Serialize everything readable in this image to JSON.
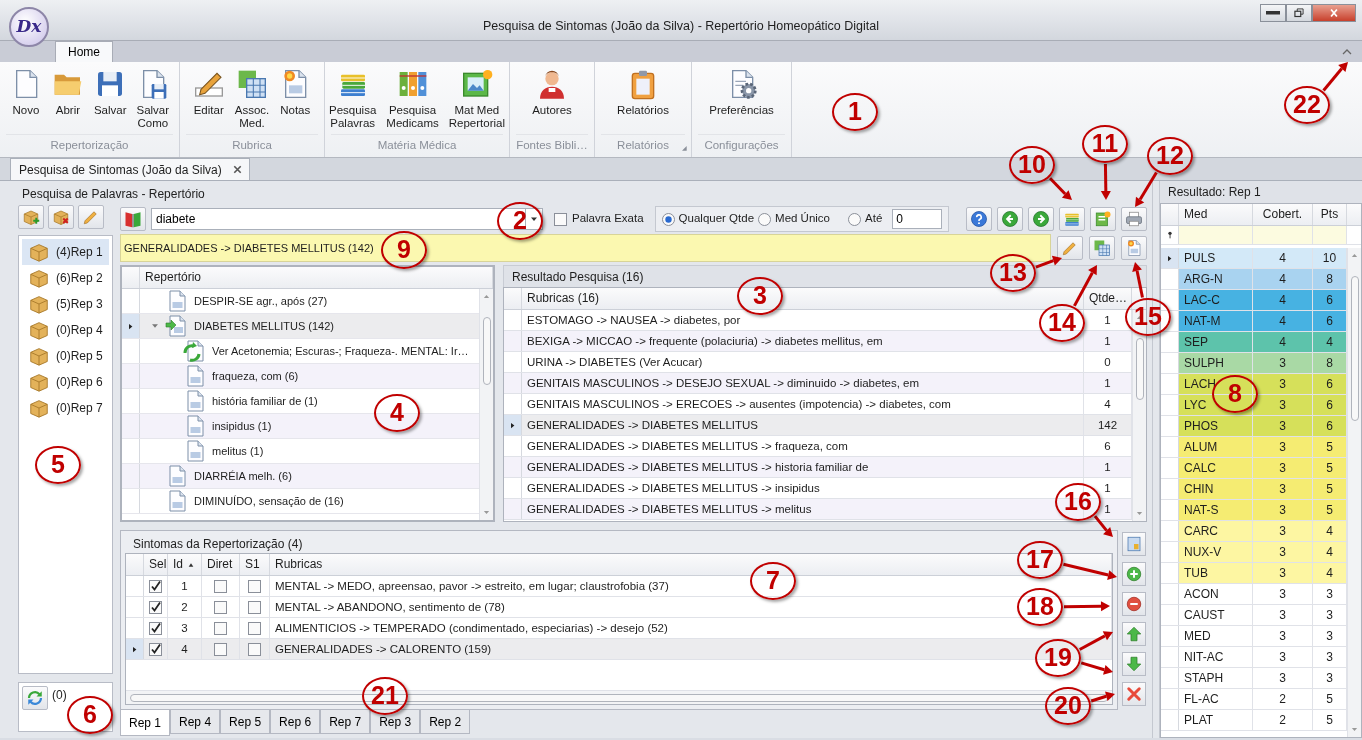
{
  "window": {
    "title": "Pesquisa de Sintomas (João da Silva) - Repertório Homeopático Digital",
    "logo": "Dx"
  },
  "ribbon": {
    "tabs": [
      {
        "label": "Home",
        "selected": true
      }
    ],
    "groups": [
      {
        "label": "Repertorização",
        "launcher": false,
        "buttons": [
          {
            "label": "Novo",
            "kind": "new"
          },
          {
            "label": "Abrir",
            "kind": "open"
          },
          {
            "label": "Salvar",
            "kind": "save"
          },
          {
            "label": "Salvar\nComo",
            "kind": "saveas"
          }
        ]
      },
      {
        "label": "Rubrica",
        "launcher": false,
        "buttons": [
          {
            "label": "Editar",
            "kind": "edit"
          },
          {
            "label": "Assoc.\nMed.",
            "kind": "grid"
          },
          {
            "label": "Notas",
            "kind": "note"
          }
        ]
      },
      {
        "label": "Matéria Médica",
        "launcher": false,
        "buttons": [
          {
            "label": "Pesquisa\nPalavras",
            "kind": "books"
          },
          {
            "label": "Pesquisa\nMedicams",
            "kind": "binders"
          },
          {
            "label": "Mat Med\nRepertorial",
            "kind": "picture"
          }
        ]
      },
      {
        "label": "Fontes Bibli…",
        "launcher": false,
        "buttons": [
          {
            "label": "Autores",
            "kind": "person"
          }
        ]
      },
      {
        "label": "Relatórios",
        "launcher": true,
        "buttons": [
          {
            "label": "Relatórios",
            "kind": "report"
          }
        ]
      },
      {
        "label": "Configurações",
        "launcher": false,
        "buttons": [
          {
            "label": "Preferências",
            "kind": "prefs"
          }
        ]
      }
    ]
  },
  "doc_tabs": [
    {
      "label": "Pesquisa de Sintomas (João da Silva)",
      "selected": true
    }
  ],
  "search_panel": {
    "title": "Pesquisa de Palavras - Repertório",
    "query": "diabete",
    "exact_word": {
      "label": "Palavra Exata",
      "checked": false
    },
    "modes": [
      {
        "label": "Qualquer Qtde",
        "selected": true
      },
      {
        "label": "Med Único",
        "selected": false
      },
      {
        "label": "Até",
        "selected": false
      }
    ],
    "limit": "0",
    "current_rubric": "GENERALIDADES -> DIABETES MELLITUS (142)"
  },
  "repertories": [
    {
      "label": "(4)Rep 1",
      "selected": true
    },
    {
      "label": "(6)Rep 2",
      "selected": false
    },
    {
      "label": "(5)Rep 3",
      "selected": false
    },
    {
      "label": "(0)Rep 4",
      "selected": false
    },
    {
      "label": "(0)Rep 5",
      "selected": false
    },
    {
      "label": "(0)Rep 6",
      "selected": false
    },
    {
      "label": "(0)Rep 7",
      "selected": false
    }
  ],
  "trash": {
    "count": "(0)"
  },
  "tree": {
    "header": "Repertório",
    "items": [
      {
        "label": "DESPIR-SE agr., após (27)",
        "kind": "page",
        "selected": false
      },
      {
        "label": "DIABETES MELLITUS (142)",
        "kind": "page-go",
        "selected": true,
        "expanded": true,
        "children": [
          {
            "label": "Ver Acetonemia; Escuras-; Fraqueza-. MENTAL: Ir…",
            "kind": "link",
            "selected": false
          },
          {
            "label": "fraqueza, com (6)",
            "kind": "page",
            "selected": false
          },
          {
            "label": "história familiar de (1)",
            "kind": "page",
            "selected": false
          },
          {
            "label": "insipidus (1)",
            "kind": "page",
            "selected": false
          },
          {
            "label": "melitus (1)",
            "kind": "page",
            "selected": false
          }
        ]
      },
      {
        "label": "DIARRÉIA melh. (6)",
        "kind": "page",
        "selected": false
      },
      {
        "label": "DIMINUÍDO, sensação de (16)",
        "kind": "page",
        "selected": false
      }
    ]
  },
  "results": {
    "title": "Resultado Pesquisa (16)",
    "columns": [
      "Rubricas (16)",
      "Qtde…"
    ],
    "rows": [
      {
        "rubric": "ESTOMAGO -> NAUSEA -> diabetes, por",
        "qty": "1",
        "selected": false
      },
      {
        "rubric": "BEXIGA -> MICCAO -> frequente (polaciuria) -> diabetes mellitus, em",
        "qty": "1",
        "selected": false
      },
      {
        "rubric": "URINA -> DIABETES (Ver Acucar)",
        "qty": "0",
        "selected": false
      },
      {
        "rubric": "GENITAIS MASCULINOS -> DESEJO SEXUAL -> diminuido -> diabetes, em",
        "qty": "1",
        "selected": false
      },
      {
        "rubric": "GENITAIS MASCULINOS -> ERECOES -> ausentes (impotencia) -> diabetes, com",
        "qty": "4",
        "selected": false
      },
      {
        "rubric": "GENERALIDADES -> DIABETES MELLITUS",
        "qty": "142",
        "selected": true
      },
      {
        "rubric": "GENERALIDADES -> DIABETES MELLITUS -> fraqueza, com",
        "qty": "6",
        "selected": false
      },
      {
        "rubric": "GENERALIDADES -> DIABETES MELLITUS -> historia familiar de",
        "qty": "1",
        "selected": false
      },
      {
        "rubric": "GENERALIDADES -> DIABETES MELLITUS -> insipidus",
        "qty": "1",
        "selected": false
      },
      {
        "rubric": "GENERALIDADES -> DIABETES MELLITUS -> melitus",
        "qty": "1",
        "selected": false
      }
    ]
  },
  "symptoms": {
    "title": "Sintomas da Repertorização (4)",
    "columns": [
      {
        "label": "Sel",
        "sorted": false
      },
      {
        "label": "Id",
        "sorted": true
      },
      {
        "label": "Diret",
        "sorted": false
      },
      {
        "label": "S1",
        "sorted": false
      },
      {
        "label": "Rubricas",
        "sorted": false
      }
    ],
    "rows": [
      {
        "sel": true,
        "id": "1",
        "diret": false,
        "s1": false,
        "rubric": "MENTAL -> MEDO, apreensao, pavor -> estreito, em lugar; claustrofobia (37)",
        "selected": false
      },
      {
        "sel": true,
        "id": "2",
        "diret": false,
        "s1": false,
        "rubric": "MENTAL -> ABANDONO, sentimento de (78)",
        "selected": false
      },
      {
        "sel": true,
        "id": "3",
        "diret": false,
        "s1": false,
        "rubric": "ALIMENTICIOS -> TEMPERADO (condimentado, especiarias) -> desejo (52)",
        "selected": false
      },
      {
        "sel": true,
        "id": "4",
        "diret": false,
        "s1": false,
        "rubric": "GENERALIDADES -> CALORENTO (159)",
        "selected": true
      }
    ]
  },
  "rep_tabs": [
    {
      "label": "Rep 1",
      "selected": true
    },
    {
      "label": "Rep 4",
      "selected": false
    },
    {
      "label": "Rep 5",
      "selected": false
    },
    {
      "label": "Rep 6",
      "selected": false
    },
    {
      "label": "Rep 7",
      "selected": false
    },
    {
      "label": "Rep 3",
      "selected": false
    },
    {
      "label": "Rep 2",
      "selected": false
    }
  ],
  "result_panel": {
    "title": "Resultado: Rep 1",
    "columns": [
      "Med",
      "Cobert.",
      "Pts"
    ],
    "rows": [
      {
        "med": "PULS",
        "coverage": "4",
        "points": "10",
        "color": "#d3e9f8",
        "selected": true
      },
      {
        "med": "ARG-N",
        "coverage": "4",
        "points": "8",
        "color": "#a9d3f0",
        "selected": false
      },
      {
        "med": "LAC-C",
        "coverage": "4",
        "points": "6",
        "color": "#47b2e2",
        "selected": false
      },
      {
        "med": "NAT-M",
        "coverage": "4",
        "points": "6",
        "color": "#47b2e2",
        "selected": false
      },
      {
        "med": "SEP",
        "coverage": "4",
        "points": "4",
        "color": "#5dc3ab",
        "selected": false
      },
      {
        "med": "SULPH",
        "coverage": "3",
        "points": "8",
        "color": "#a9d9a5",
        "selected": false
      },
      {
        "med": "LACH",
        "coverage": "3",
        "points": "6",
        "color": "#d6e05a",
        "selected": false
      },
      {
        "med": "LYC",
        "coverage": "3",
        "points": "6",
        "color": "#d6e05a",
        "selected": false
      },
      {
        "med": "PHOS",
        "coverage": "3",
        "points": "6",
        "color": "#d6e05a",
        "selected": false
      },
      {
        "med": "ALUM",
        "coverage": "3",
        "points": "5",
        "color": "#f5ec72",
        "selected": false
      },
      {
        "med": "CALC",
        "coverage": "3",
        "points": "5",
        "color": "#f5ec72",
        "selected": false
      },
      {
        "med": "CHIN",
        "coverage": "3",
        "points": "5",
        "color": "#f5ec72",
        "selected": false
      },
      {
        "med": "NAT-S",
        "coverage": "3",
        "points": "5",
        "color": "#f5ec72",
        "selected": false
      },
      {
        "med": "CARC",
        "coverage": "3",
        "points": "4",
        "color": "#fdf6a2",
        "selected": false
      },
      {
        "med": "NUX-V",
        "coverage": "3",
        "points": "4",
        "color": "#fdf6a2",
        "selected": false
      },
      {
        "med": "TUB",
        "coverage": "3",
        "points": "4",
        "color": "#fdf6a2",
        "selected": false
      },
      {
        "med": "ACON",
        "coverage": "3",
        "points": "3",
        "color": "#ffffff",
        "selected": false
      },
      {
        "med": "CAUST",
        "coverage": "3",
        "points": "3",
        "color": "#ffffff",
        "selected": false
      },
      {
        "med": "MED",
        "coverage": "3",
        "points": "3",
        "color": "#ffffff",
        "selected": false
      },
      {
        "med": "NIT-AC",
        "coverage": "3",
        "points": "3",
        "color": "#ffffff",
        "selected": false
      },
      {
        "med": "STAPH",
        "coverage": "3",
        "points": "3",
        "color": "#ffffff",
        "selected": false
      },
      {
        "med": "FL-AC",
        "coverage": "2",
        "points": "5",
        "color": "#ffffff",
        "selected": false
      },
      {
        "med": "PLAT",
        "coverage": "2",
        "points": "5",
        "color": "#ffffff",
        "selected": false
      }
    ]
  },
  "annotations": [
    {
      "number": "1"
    },
    {
      "number": "2"
    },
    {
      "number": "3"
    },
    {
      "number": "4"
    },
    {
      "number": "5"
    },
    {
      "number": "6"
    },
    {
      "number": "7"
    },
    {
      "number": "8"
    },
    {
      "number": "9"
    },
    {
      "number": "10"
    },
    {
      "number": "11"
    },
    {
      "number": "12"
    },
    {
      "number": "13"
    },
    {
      "number": "14"
    },
    {
      "number": "15"
    },
    {
      "number": "16"
    },
    {
      "number": "17"
    },
    {
      "number": "18"
    },
    {
      "number": "19"
    },
    {
      "number": "20"
    },
    {
      "number": "21"
    },
    {
      "number": "22"
    }
  ]
}
